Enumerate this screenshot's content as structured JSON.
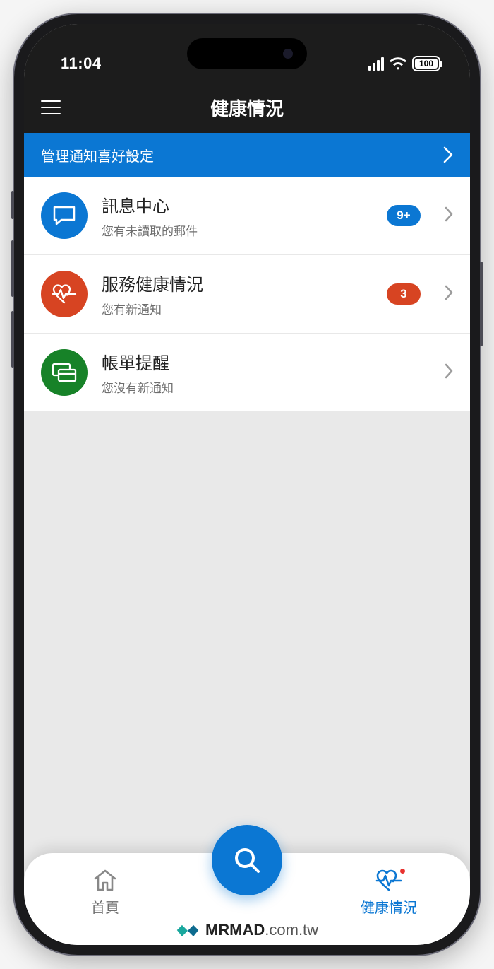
{
  "status": {
    "time": "11:04",
    "battery": "100"
  },
  "header": {
    "title": "健康情況"
  },
  "banner": {
    "label": "管理通知喜好設定"
  },
  "items": [
    {
      "title": "訊息中心",
      "subtitle": "您有未讀取的郵件",
      "badge": "9+",
      "badgeColor": "blue",
      "iconColor": "blue",
      "icon": "message"
    },
    {
      "title": "服務健康情況",
      "subtitle": "您有新通知",
      "badge": "3",
      "badgeColor": "orange",
      "iconColor": "orange",
      "icon": "heart"
    },
    {
      "title": "帳單提醒",
      "subtitle": "您沒有新通知",
      "badge": "",
      "badgeColor": "",
      "iconColor": "green",
      "icon": "card"
    }
  ],
  "tabs": {
    "home": "首頁",
    "health": "健康情況"
  },
  "watermark": {
    "bold": "MRMAD",
    "rest": ".com.tw"
  }
}
